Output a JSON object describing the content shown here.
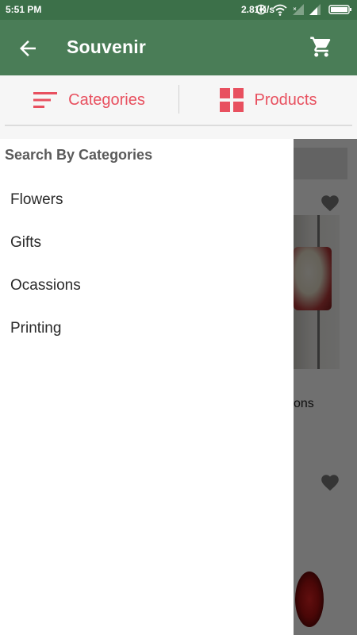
{
  "status_bar": {
    "time": "5:51 PM",
    "network_speed": "2.81K/s",
    "icons": [
      "vpn-icon",
      "wifi-icon",
      "signal-icon",
      "signal-icon",
      "battery-icon"
    ]
  },
  "app_bar": {
    "title": "Souvenir",
    "back_icon": "arrow-back-icon",
    "cart_icon": "shopping-cart-icon",
    "color": "#4a7d57"
  },
  "tabs": [
    {
      "label": "Categories",
      "icon": "sort-icon"
    },
    {
      "label": "Products",
      "icon": "grid-icon"
    }
  ],
  "accent_color": "#e8505f",
  "drawer": {
    "heading": "Search By Categories",
    "items": [
      "Flowers",
      "Gifts",
      "Ocassions",
      "Printing"
    ]
  },
  "background": {
    "partial_text": "ons",
    "icons": [
      "heart-icon",
      "heart-icon"
    ]
  }
}
